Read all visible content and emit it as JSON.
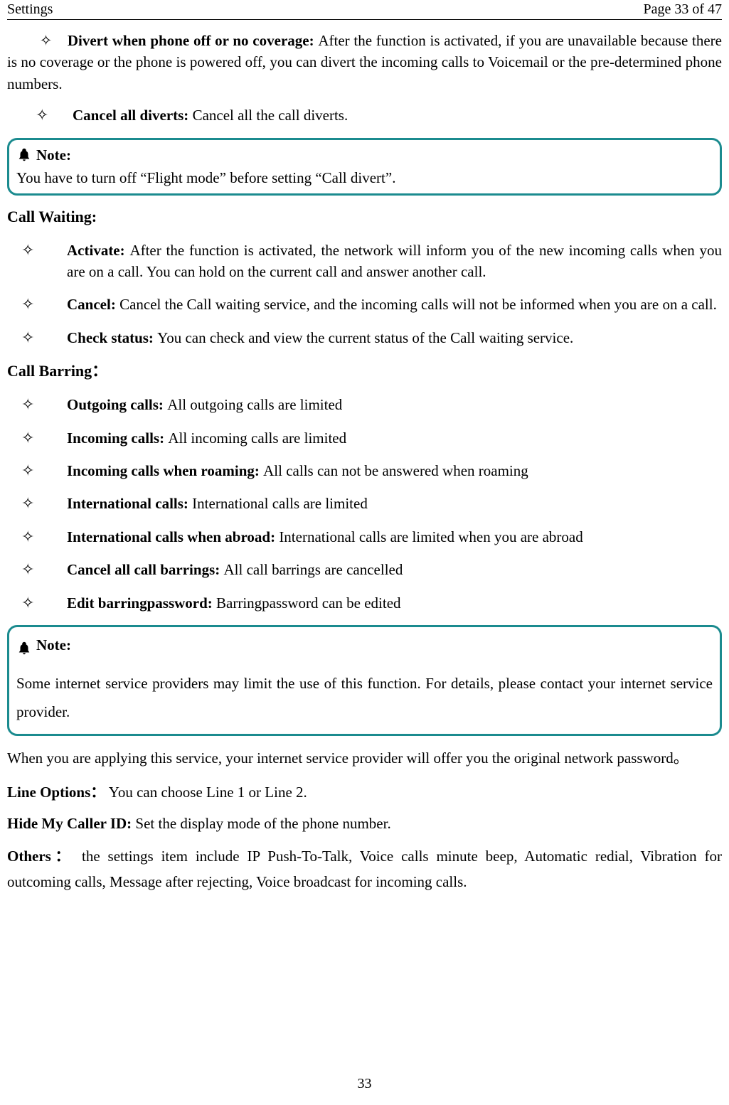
{
  "header": {
    "title": "Settings",
    "pageIndicator": "Page 33 of 47"
  },
  "sections": {
    "divertOff": {
      "label": "Divert when phone off or no coverage: ",
      "text": "After the function is activated, if you are unavailable because there is no coverage or the phone is powered off, you can divert the incoming calls to Voicemail or the pre-determined phone numbers."
    },
    "cancelDiverts": {
      "label": "Cancel all diverts: ",
      "text": "Cancel all the call diverts."
    },
    "note1": {
      "label": "Note:",
      "text": "You have to turn off “Flight mode” before setting “Call divert”."
    },
    "callWaiting": {
      "heading": "Call Waiting:",
      "activate": {
        "label": "Activate: ",
        "text": "After the function is activated, the network will inform you of the new incoming calls when you are on a call. You can hold on the current call and answer another call."
      },
      "cancel": {
        "label": "Cancel: ",
        "text": "Cancel the Call waiting service, and the incoming calls will not be informed when you are on a call."
      },
      "check": {
        "label": "Check status: ",
        "text": "You can check and view the current status of the Call waiting service."
      }
    },
    "callBarring": {
      "heading": "Call Barring：",
      "items": [
        {
          "label": "Outgoing calls: ",
          "text": "All outgoing calls are limited"
        },
        {
          "label": "Incoming calls: ",
          "text": "All incoming calls are limited"
        },
        {
          "label": "Incoming calls when roaming: ",
          "text": "All calls can not be answered when roaming"
        },
        {
          "label": "International calls: ",
          "text": "International calls are limited"
        },
        {
          "label": "International calls when abroad: ",
          "text": "International calls are limited when you are abroad"
        },
        {
          "label": "Cancel all call barrings: ",
          "text": "All call barrings are cancelled"
        },
        {
          "label": "Edit barringpassword: ",
          "text": "Barringpassword can be edited"
        }
      ]
    },
    "note2": {
      "label": "Note:",
      "text": "Some internet service providers may limit the use of this function. For details, please contact your internet service provider."
    },
    "applying": "When you are applying this service, your internet service provider will offer you the original network password。",
    "lineOptions": {
      "label": "Line Options：",
      "text": "You can choose Line 1 or Line 2."
    },
    "hideCaller": {
      "label": "Hide My Caller ID: ",
      "text": "Set the display mode of the phone number."
    },
    "others": {
      "label": "Others：",
      "text": "the settings item include IP Push-To-Talk, Voice calls minute beep, Automatic redial, Vibration for outcoming calls, Message after rejecting, Voice broadcast for incoming calls."
    }
  },
  "footer": {
    "pageNumber": "33"
  }
}
